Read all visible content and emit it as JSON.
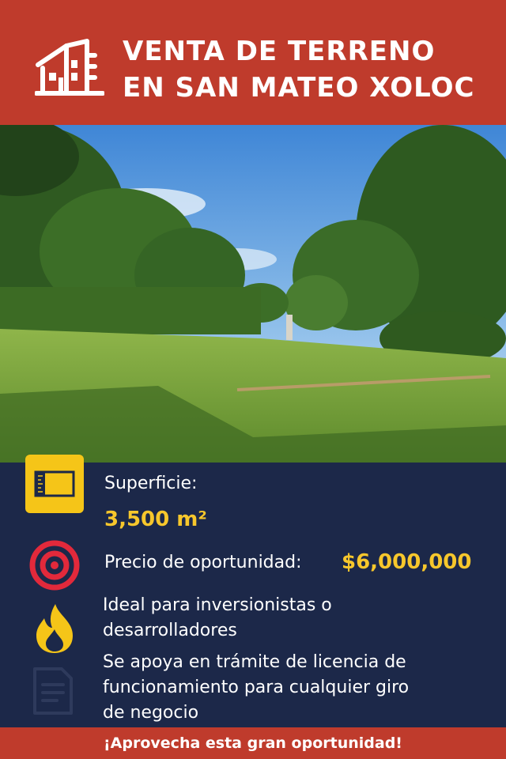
{
  "header": {
    "title_line1": "VENTA DE TERRENO",
    "title_line2": "EN SAN MATEO XOLOC",
    "logo_icon": "building-icon"
  },
  "photo": {
    "description_icon": "land-photo"
  },
  "features": [
    {
      "icon": "ruler-icon",
      "label": "Superficie:",
      "value": "3,500 m²"
    },
    {
      "icon": "target-icon",
      "label": "Precio de oportunidad:",
      "value": "$6,000,000"
    },
    {
      "icon": "flame-icon",
      "text_line1": "Ideal para inversionistas o",
      "text_line2": "desarrolladores"
    },
    {
      "icon": "document-icon",
      "text_line1": "Se apoya en trámite de licencia de",
      "text_line2": "funcionamiento para cualquier giro",
      "text_line3": "de negocio"
    }
  ],
  "footer": {
    "text": "¡Aprovecha esta gran oportunidad!"
  },
  "colors": {
    "header": "#bf3b2c",
    "panel": "#1c2849",
    "accent": "#f7c72c"
  }
}
